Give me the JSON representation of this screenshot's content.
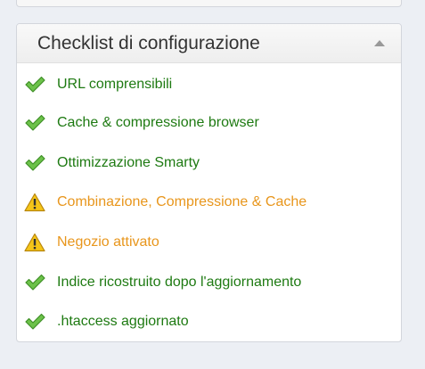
{
  "panel": {
    "title": "Checklist di configurazione",
    "toggle_icon": "chevron-up-icon"
  },
  "checklist": [
    {
      "label": "URL comprensibili",
      "status": "ok",
      "icon": "check-icon"
    },
    {
      "label": "Cache & compressione browser",
      "status": "ok",
      "icon": "check-icon"
    },
    {
      "label": "Ottimizzazione Smarty",
      "status": "ok",
      "icon": "check-icon"
    },
    {
      "label": "Combinazione, Compressione & Cache",
      "status": "warning",
      "icon": "warning-icon"
    },
    {
      "label": "Negozio attivato",
      "status": "warning",
      "icon": "warning-icon"
    },
    {
      "label": "Indice ricostruito dopo l'aggiornamento",
      "status": "ok",
      "icon": "check-icon"
    },
    {
      "label": ".htaccess aggiornato",
      "status": "ok",
      "icon": "check-icon"
    }
  ],
  "colors": {
    "ok_text": "#1e7a12",
    "warning_text": "#e8961c",
    "check_fill": "#6cc24a",
    "warning_fill": "#f5c518"
  }
}
